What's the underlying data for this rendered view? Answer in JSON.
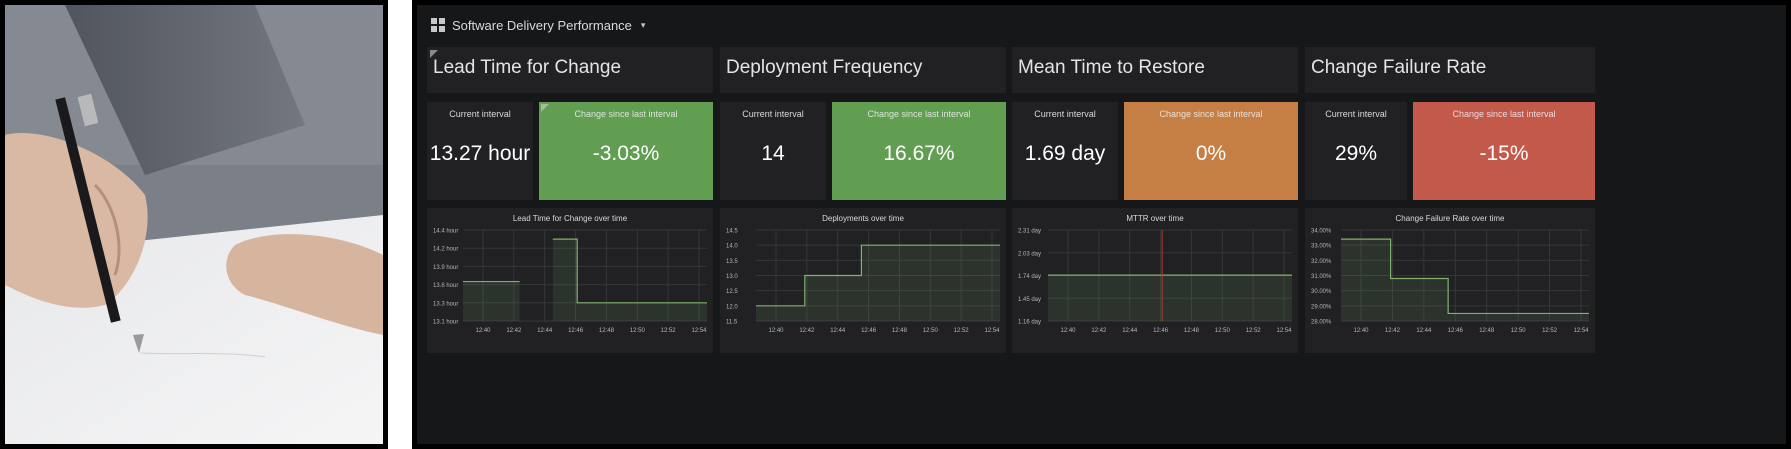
{
  "dashboard": {
    "title": "Software Delivery Performance",
    "grid_icon": "dashboard-grid-icon",
    "caret_icon": "caret-down-icon",
    "caret_glyph": "▾"
  },
  "colors": {
    "background": "#161719",
    "panel": "#212124",
    "green": "#629e51",
    "orange": "#c57f45",
    "red": "#c2594a",
    "line": "#7eb26d"
  },
  "photo": {
    "subject": "hand signing a document with a pen"
  },
  "panels": [
    {
      "title": "Lead Time for Change",
      "current_label": "Current interval",
      "current_value": "13.27 hour",
      "change_label": "Change since last interval",
      "change_value": "-3.03%",
      "change_color": "#629e51",
      "graph_title": "Lead Time for Change over time",
      "y_ticks": [
        "14.4 hour",
        "14.2 hour",
        "13.9 hour",
        "13.6 hour",
        "13.3 hour",
        "13.1 hour"
      ],
      "x_ticks": [
        "12:40",
        "12:42",
        "12:44",
        "12:46",
        "12:48",
        "12:50",
        "12:52",
        "12:54"
      ]
    },
    {
      "title": "Deployment Frequency",
      "current_label": "Current interval",
      "current_value": "14",
      "change_label": "Change since last interval",
      "change_value": "16.67%",
      "change_color": "#629e51",
      "graph_title": "Deployments over time",
      "y_ticks": [
        "14.5",
        "14.0",
        "13.5",
        "13.0",
        "12.5",
        "12.0",
        "11.5"
      ],
      "x_ticks": [
        "12:40",
        "12:42",
        "12:44",
        "12:46",
        "12:48",
        "12:50",
        "12:52",
        "12:54"
      ]
    },
    {
      "title": "Mean Time to Restore",
      "current_label": "Current interval",
      "current_value": "1.69 day",
      "change_label": "Change since last interval",
      "change_value": "0%",
      "change_color": "#c57f45",
      "graph_title": "MTTR over time",
      "y_ticks": [
        "2.31 day",
        "2.03 day",
        "1.74 day",
        "1.45 day",
        "1.16 day"
      ],
      "x_ticks": [
        "12:40",
        "12:42",
        "12:44",
        "12:46",
        "12:48",
        "12:50",
        "12:52",
        "12:54"
      ]
    },
    {
      "title": "Change Failure Rate",
      "current_label": "Current interval",
      "current_value": "29%",
      "change_label": "Change since last interval",
      "change_value": "-15%",
      "change_color": "#c2594a",
      "graph_title": "Change Failure Rate over time",
      "y_ticks": [
        "34.00%",
        "33.00%",
        "32.00%",
        "31.00%",
        "30.00%",
        "29.00%",
        "28.00%"
      ],
      "x_ticks": [
        "12:40",
        "12:42",
        "12:44",
        "12:46",
        "12:48",
        "12:50",
        "12:52",
        "12:54"
      ]
    }
  ],
  "chart_data": [
    {
      "type": "line",
      "title": "Lead Time for Change over time",
      "x": [
        "12:39",
        "12:42.5",
        "12:44.5",
        "12:46",
        "12:54"
      ],
      "series": [
        {
          "values": [
            13.65,
            null,
            14.35,
            13.3,
            13.3
          ]
        }
      ],
      "segments": [
        {
          "x": [
            12.65,
            12.708
          ],
          "y": [
            13.65,
            13.65
          ]
        },
        {
          "x": [
            12.742,
            12.767,
            12.767,
            12.9
          ],
          "y": [
            14.35,
            14.35,
            13.3,
            13.3
          ]
        }
      ],
      "ylim": [
        13.0,
        14.5
      ],
      "xlim": [
        12.65,
        12.9
      ],
      "grid": true
    },
    {
      "type": "line",
      "title": "Deployments over time",
      "series": [
        {
          "x": [
            12.65,
            12.7,
            12.7,
            12.758,
            12.758,
            12.9
          ],
          "y": [
            12.0,
            12.0,
            13.0,
            13.0,
            14.0,
            14.0
          ]
        }
      ],
      "ylim": [
        11.5,
        14.5
      ],
      "xlim": [
        12.65,
        12.9
      ],
      "grid": true
    },
    {
      "type": "line",
      "title": "MTTR over time",
      "series": [
        {
          "x": [
            12.65,
            12.9
          ],
          "y": [
            1.74,
            1.74
          ]
        }
      ],
      "annotations": [
        {
          "x": 12.767,
          "color": "#b03a2e"
        }
      ],
      "ylim": [
        1.16,
        2.31
      ],
      "xlim": [
        12.65,
        12.9
      ],
      "grid": true
    },
    {
      "type": "line",
      "title": "Change Failure Rate over time",
      "series": [
        {
          "x": [
            12.65,
            12.7,
            12.7,
            12.758,
            12.758,
            12.9
          ],
          "y": [
            33.4,
            33.4,
            30.8,
            30.8,
            28.5,
            28.5
          ]
        }
      ],
      "ylim": [
        28.0,
        34.0
      ],
      "xlim": [
        12.65,
        12.9
      ],
      "grid": true
    }
  ]
}
